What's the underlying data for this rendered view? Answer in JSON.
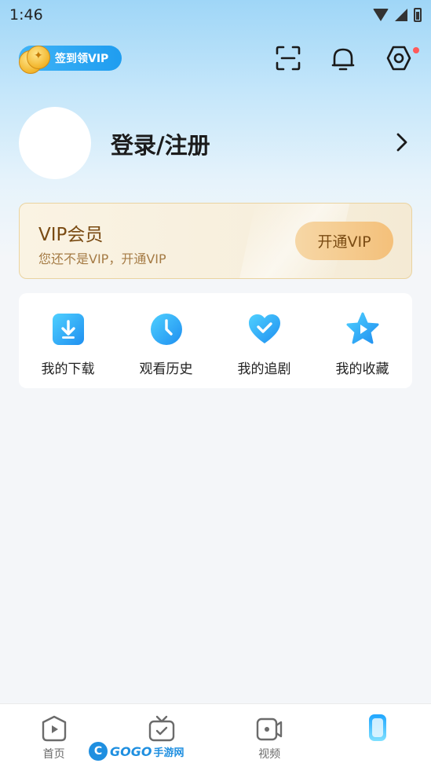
{
  "status_bar": {
    "time": "1:46",
    "icons": [
      "wifi-icon",
      "signal-icon",
      "battery-icon"
    ]
  },
  "header": {
    "signin_label": "签到领VIP",
    "icons": [
      "scan-icon",
      "bell-icon",
      "settings-icon"
    ],
    "settings_has_notification": true
  },
  "profile": {
    "login_label": "登录/注册"
  },
  "vip": {
    "title": "VIP会员",
    "subtitle": "您还不是VIP，开通VIP",
    "button_label": "开通VIP"
  },
  "quick_actions": [
    {
      "label": "我的下载",
      "icon": "download-icon"
    },
    {
      "label": "观看历史",
      "icon": "history-clock-icon"
    },
    {
      "label": "我的追剧",
      "icon": "heart-check-icon"
    },
    {
      "label": "我的收藏",
      "icon": "star-play-icon"
    }
  ],
  "bottom_nav": [
    {
      "label": "首页",
      "icon": "home-play-icon"
    },
    {
      "label": "",
      "icon": "tv-check-icon"
    },
    {
      "label": "视频",
      "icon": "video-camera-icon"
    },
    {
      "label": "",
      "icon": "profile-active-icon"
    }
  ],
  "watermark": {
    "logo_letter": "C",
    "text": "GOGO",
    "text2": "手游网"
  },
  "colors": {
    "accent_blue": "#1f9df0",
    "vip_gold": "#7a4b13",
    "notification_red": "#ff5a5a"
  }
}
